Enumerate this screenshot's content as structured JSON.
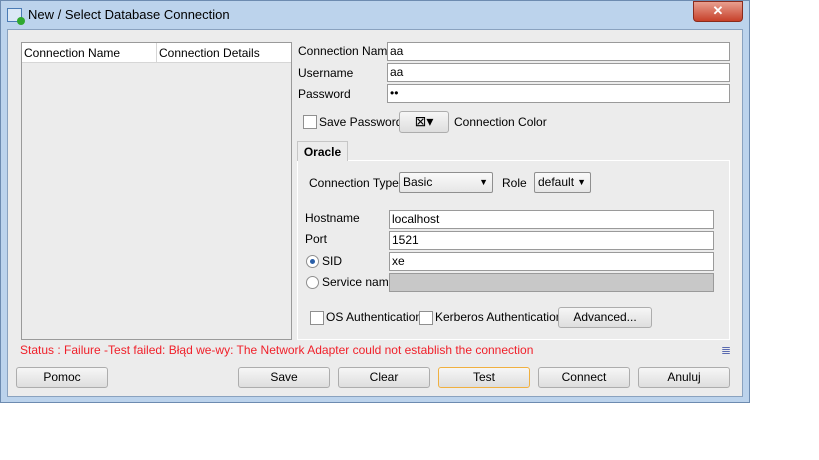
{
  "window": {
    "title": "New / Select Database Connection",
    "close": "✕"
  },
  "list": {
    "columns": [
      "Connection Name",
      "Connection Details"
    ]
  },
  "form": {
    "connection_name": {
      "label": "Connection Name",
      "value": "aa"
    },
    "username": {
      "label": "Username",
      "value": "aa"
    },
    "password": {
      "label": "Password",
      "value": "••"
    },
    "save_password": {
      "label": "Save Password",
      "checked": false
    },
    "connection_color": {
      "label": "Connection Color"
    }
  },
  "tabs": [
    "Oracle"
  ],
  "oracle": {
    "connection_type": {
      "label": "Connection Type",
      "value": "Basic"
    },
    "role": {
      "label": "Role",
      "value": "default"
    },
    "hostname": {
      "label": "Hostname",
      "value": "localhost"
    },
    "port": {
      "label": "Port",
      "value": "1521"
    },
    "sid": {
      "label": "SID",
      "value": "xe",
      "selected": true
    },
    "service_name": {
      "label": "Service name",
      "value": ""
    },
    "os_auth": {
      "label": "OS Authentication",
      "checked": false
    },
    "kerberos_auth": {
      "label": "Kerberos Authentication",
      "checked": false
    },
    "advanced": "Advanced..."
  },
  "status": "Status : Failure -Test failed: Błąd we-wy: The Network Adapter could not establish the connection",
  "buttons": {
    "help": "Pomoc",
    "save": "Save",
    "clear": "Clear",
    "test": "Test",
    "connect": "Connect",
    "cancel": "Anuluj"
  }
}
